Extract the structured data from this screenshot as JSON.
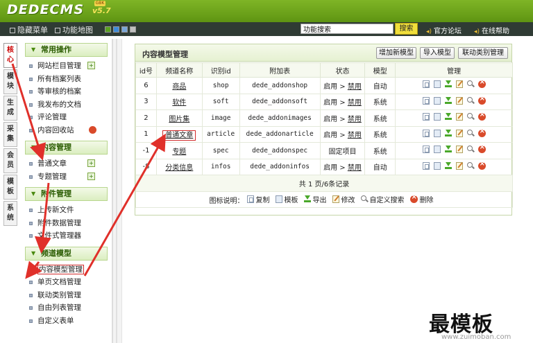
{
  "header": {
    "logo": "DEDECMS",
    "version": "v5.7",
    "badge": "GBK"
  },
  "topbar": {
    "hide_menu": "隐藏菜单",
    "feature_map": "功能地图",
    "search_value": "功能搜索",
    "search_button": "搜索",
    "forum_link": "官方论坛",
    "help_link": "在线帮助",
    "skin_colors": [
      "#5aa020",
      "#3e8ad8",
      "#7aa6d8",
      "#c0c0c0"
    ]
  },
  "vtabs": [
    {
      "label": [
        "核",
        "心"
      ],
      "active": true
    },
    {
      "label": [
        "模",
        "块"
      ],
      "active": false
    },
    {
      "label": [
        "生",
        "成"
      ],
      "active": false
    },
    {
      "label": [
        "采",
        "集"
      ],
      "active": false
    },
    {
      "label": [
        "会",
        "员"
      ],
      "active": false
    },
    {
      "label": [
        "模",
        "板"
      ],
      "active": false
    },
    {
      "label": [
        "系",
        "统"
      ],
      "active": false
    }
  ],
  "sidebar": {
    "groups": [
      {
        "title": "常用操作",
        "items": [
          {
            "label": "网站栏目管理",
            "icon": "plus"
          },
          {
            "label": "所有档案列表",
            "icon": ""
          },
          {
            "label": "等审核的档案",
            "icon": ""
          },
          {
            "label": "我发布的文档",
            "icon": ""
          },
          {
            "label": "评论管理",
            "icon": ""
          },
          {
            "label": "内容回收站",
            "icon": "trash"
          }
        ]
      },
      {
        "title": "内容管理",
        "items": [
          {
            "label": "普通文章",
            "icon": "plus"
          },
          {
            "label": "专题管理",
            "icon": "plus"
          }
        ]
      },
      {
        "title": "附件管理",
        "items": [
          {
            "label": "上传新文件",
            "icon": ""
          },
          {
            "label": "附件数据管理",
            "icon": ""
          },
          {
            "label": "文件式管理器",
            "icon": ""
          }
        ]
      },
      {
        "title": "频道模型",
        "items": [
          {
            "label": "内容模型管理",
            "icon": "",
            "selected": true
          },
          {
            "label": "单页文档管理",
            "icon": ""
          },
          {
            "label": "联动类别管理",
            "icon": ""
          },
          {
            "label": "自由列表管理",
            "icon": ""
          },
          {
            "label": "自定义表单",
            "icon": ""
          }
        ]
      }
    ]
  },
  "panel": {
    "title": "内容模型管理",
    "buttons": {
      "add_model": "增加新模型",
      "import_model": "导入模型",
      "linkage": "联动类别管理"
    },
    "columns": [
      "id号",
      "频道名称",
      "识别id",
      "附加表",
      "状态",
      "模型",
      "管理"
    ],
    "rows": [
      {
        "id": "6",
        "name": "商品",
        "ident": "shop",
        "table": "dede_addonshop",
        "status": "启用",
        "action": "禁用",
        "model": "自动"
      },
      {
        "id": "3",
        "name": "软件",
        "ident": "soft",
        "table": "dede_addonsoft",
        "status": "启用",
        "action": "禁用",
        "model": "系统"
      },
      {
        "id": "2",
        "name": "图片集",
        "ident": "image",
        "table": "dede_addonimages",
        "status": "启用",
        "action": "禁用",
        "model": "系统"
      },
      {
        "id": "1",
        "name": "普通文章",
        "ident": "article",
        "table": "dede_addonarticle",
        "status": "启用",
        "action": "禁用",
        "model": "系统",
        "boxed": true
      },
      {
        "id": "-1",
        "name": "专题",
        "ident": "spec",
        "table": "dede_addonspec",
        "status": "固定项目",
        "action": "",
        "model": "系统"
      },
      {
        "id": "-8",
        "name": "分类信息",
        "ident": "infos",
        "table": "dede_addoninfos",
        "status": "启用",
        "action": "禁用",
        "model": "自动"
      }
    ],
    "pager": "共 1 页/6条记录",
    "legend": {
      "title": "图标说明：",
      "items": [
        {
          "icon": "copy",
          "label": "复制"
        },
        {
          "icon": "tpl",
          "label": "模板"
        },
        {
          "icon": "exp",
          "label": "导出"
        },
        {
          "icon": "edit",
          "label": "修改"
        },
        {
          "icon": "srch",
          "label": "自定义搜索"
        },
        {
          "icon": "del",
          "label": "删除"
        }
      ]
    }
  },
  "watermark": {
    "text": "最模板",
    "url": "www.zuimoban.com"
  }
}
